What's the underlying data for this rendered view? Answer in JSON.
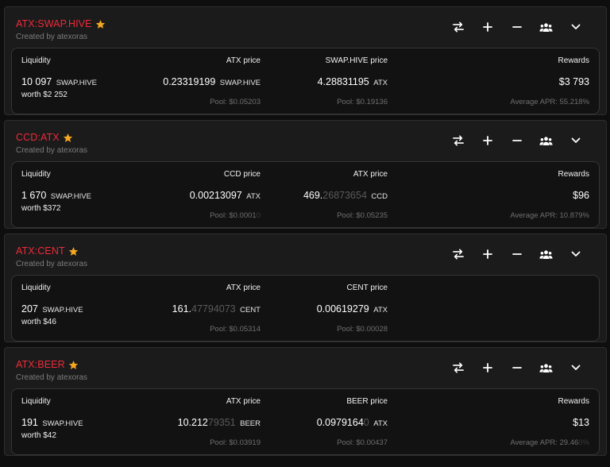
{
  "pools": [
    {
      "name": "ATX:SWAP.HIVE",
      "created_by": "Created by atexoras",
      "liquidity_label": "Liquidity",
      "liquidity_value": "10 097",
      "liquidity_unit": "SWAP.HIVE",
      "worth": "worth $2 252",
      "price1_label": "ATX price",
      "price1_bright": "0.23319199",
      "price1_dim": "",
      "price1_unit": "SWAP.HIVE",
      "price1_pool_bright": "Pool: $0.05203",
      "price1_pool_dim": "",
      "price2_label": "SWAP.HIVE price",
      "price2_bright": "4.28831195",
      "price2_dim": "",
      "price2_unit": "ATX",
      "price2_pool_bright": "Pool: $0.19136",
      "price2_pool_dim": "",
      "rewards_label": "Rewards",
      "rewards_value": "$3 793",
      "apr_bright": "Average APR: 55.218%",
      "apr_dim": ""
    },
    {
      "name": "CCD:ATX",
      "created_by": "Created by atexoras",
      "liquidity_label": "Liquidity",
      "liquidity_value": "1 670",
      "liquidity_unit": "SWAP.HIVE",
      "worth": "worth $372",
      "price1_label": "CCD price",
      "price1_bright": "0.00213097",
      "price1_dim": "",
      "price1_unit": "ATX",
      "price1_pool_bright": "Pool: $0.0001",
      "price1_pool_dim": "0",
      "price2_label": "ATX price",
      "price2_bright": "469.",
      "price2_dim": "26873654",
      "price2_unit": "CCD",
      "price2_pool_bright": "Pool: $0.05235",
      "price2_pool_dim": "",
      "rewards_label": "Rewards",
      "rewards_value": "$96",
      "apr_bright": "Average APR: 10.879%",
      "apr_dim": ""
    },
    {
      "name": "ATX:CENT",
      "created_by": "Created by atexoras",
      "liquidity_label": "Liquidity",
      "liquidity_value": "207",
      "liquidity_unit": "SWAP.HIVE",
      "worth": "worth $46",
      "price1_label": "ATX price",
      "price1_bright": "161.",
      "price1_dim": "47794073",
      "price1_unit": "CENT",
      "price1_pool_bright": "Pool: $0.05314",
      "price1_pool_dim": "",
      "price2_label": "CENT price",
      "price2_bright": "0.00619279",
      "price2_dim": "",
      "price2_unit": "ATX",
      "price2_pool_bright": "Pool: $0.00028",
      "price2_pool_dim": "",
      "rewards_label": "",
      "rewards_value": "",
      "apr_bright": "",
      "apr_dim": ""
    },
    {
      "name": "ATX:BEER",
      "created_by": "Created by atexoras",
      "liquidity_label": "Liquidity",
      "liquidity_value": "191",
      "liquidity_unit": "SWAP.HIVE",
      "worth": "worth $42",
      "price1_label": "ATX price",
      "price1_bright": "10.212",
      "price1_dim": "79351",
      "price1_unit": "BEER",
      "price1_pool_bright": "Pool: $0.03919",
      "price1_pool_dim": "",
      "price2_label": "BEER price",
      "price2_bright": "0.0979164",
      "price2_dim": "0",
      "price2_unit": "ATX",
      "price2_pool_bright": "Pool: $0.00437",
      "price2_pool_dim": "",
      "rewards_label": "Rewards",
      "rewards_value": "$13",
      "apr_bright": "Average APR: 29.46",
      "apr_dim": "0%"
    }
  ],
  "icons": [
    "swap-icon",
    "plus-icon",
    "minus-icon",
    "users-icon",
    "chevron-down-icon",
    "star-icon"
  ],
  "colors": {
    "pool_name": "#ef2a3a",
    "star": "#f5a623",
    "background": "#0e0e0e",
    "panel": "#1b1b1b",
    "card": "#121212"
  }
}
